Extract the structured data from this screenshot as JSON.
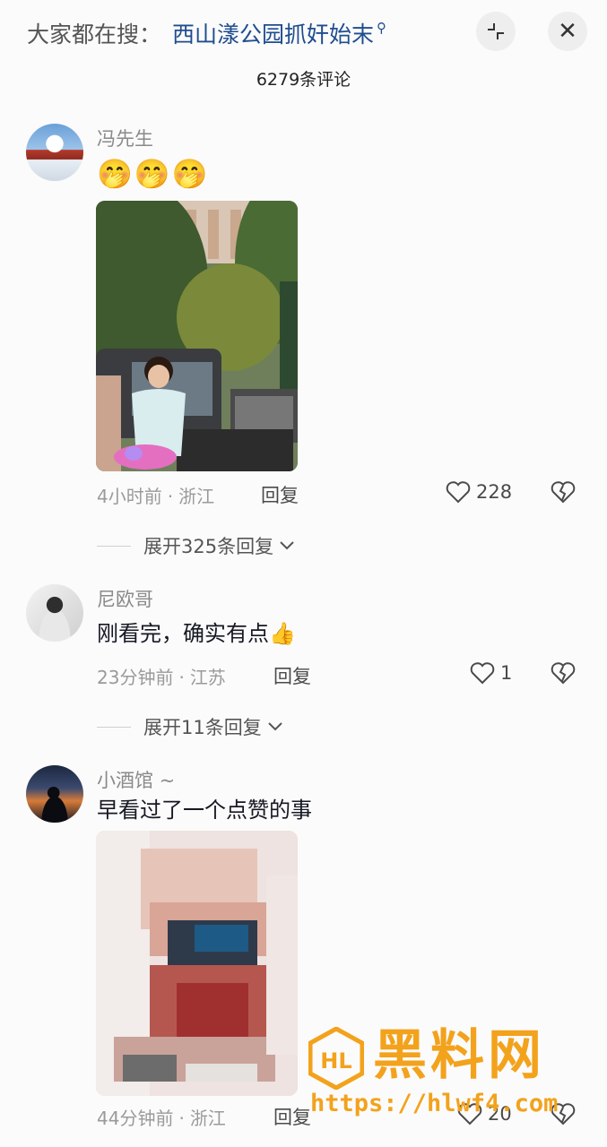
{
  "search_bar": {
    "prefix": "大家都在搜：",
    "query": "西山漾公园抓奸始末",
    "icon": "search-icon"
  },
  "header": {
    "collapse_icon": "collapse-icon",
    "close_icon": "close-icon",
    "comment_count": "6279条评论"
  },
  "comments": [
    {
      "username": "冯先生",
      "text": "🤭🤭🤭",
      "has_image": true,
      "time": "4小时前",
      "location": "浙江",
      "reply_label": "回复",
      "likes": "228",
      "expand_label": "展开325条回复"
    },
    {
      "username": "尼欧哥",
      "text": "刚看完，确实有点👍",
      "has_image": false,
      "time": "23分钟前",
      "location": "江苏",
      "reply_label": "回复",
      "likes": "1",
      "expand_label": "展开11条回复"
    },
    {
      "username": "小酒馆 ~",
      "text": "早看过了一个点赞的事",
      "has_image": true,
      "time": "44分钟前",
      "location": "浙江",
      "reply_label": "回复",
      "likes": "20"
    }
  ],
  "meta_separator": "·",
  "watermark": {
    "title": "黑料网",
    "url": "https://hlwf4.com",
    "logo_text": "HL"
  },
  "colors": {
    "accent_link": "#1f4d8f",
    "watermark": "#f3a21c",
    "muted_text": "#9a9a9a"
  }
}
